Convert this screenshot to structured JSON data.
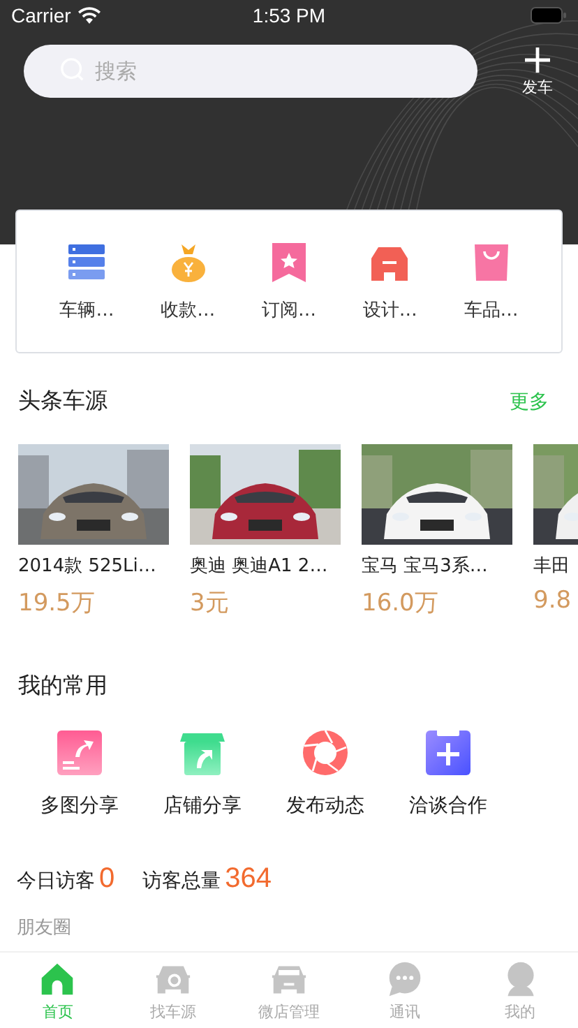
{
  "status_bar": {
    "carrier": "Carrier",
    "time": "1:53 PM"
  },
  "header": {
    "search": {
      "placeholder": "搜索"
    },
    "post_button": "发车"
  },
  "shortcuts": [
    {
      "label": "车辆…"
    },
    {
      "label": "收款…"
    },
    {
      "label": "订阅…"
    },
    {
      "label": "设计…"
    },
    {
      "label": "车品…"
    }
  ],
  "headline_cars": {
    "title": "头条车源",
    "more": "更多",
    "cars": [
      {
        "title": "2014款 525Li…",
        "price": "19.5万"
      },
      {
        "title": "奥迪 奥迪A1 2…",
        "price": "3元"
      },
      {
        "title": "宝马 宝马3系…",
        "price": "16.0万"
      },
      {
        "title": "丰田",
        "price": "9.8"
      }
    ]
  },
  "favorites": {
    "title": "我的常用",
    "items": [
      {
        "label": "多图分享"
      },
      {
        "label": "店铺分享"
      },
      {
        "label": "发布动态"
      },
      {
        "label": "洽谈合作"
      }
    ]
  },
  "visitors": {
    "today_label": "今日访客",
    "today_value": "0",
    "total_label": "访客总量",
    "total_value": "364"
  },
  "moments": {
    "title": "朋友圈"
  },
  "tab_bar": [
    {
      "label": "首页",
      "selected": true
    },
    {
      "label": "找车源",
      "selected": false
    },
    {
      "label": "微店管理",
      "selected": false
    },
    {
      "label": "通讯",
      "selected": false
    },
    {
      "label": "我的",
      "selected": false
    }
  ]
}
